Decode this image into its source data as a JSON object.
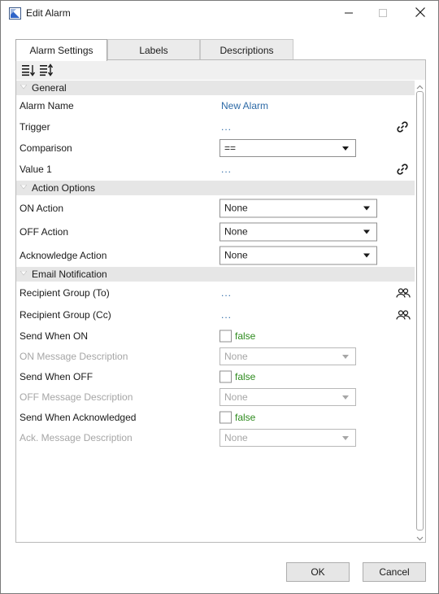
{
  "window": {
    "title": "Edit Alarm",
    "icons": [
      "app-icon",
      "minimize-icon",
      "maximize-icon",
      "close-icon"
    ]
  },
  "tabs": [
    {
      "label": "Alarm Settings",
      "active": true
    },
    {
      "label": "Labels",
      "active": false
    },
    {
      "label": "Descriptions",
      "active": false
    }
  ],
  "toolbar": {
    "icons": [
      "sort-categorized-icon",
      "sort-alphabetical-icon"
    ]
  },
  "sections": {
    "general": {
      "title": "General",
      "alarm_name": {
        "label": "Alarm Name",
        "value": "New Alarm"
      },
      "trigger": {
        "label": "Trigger",
        "value": "..."
      },
      "comparison": {
        "label": "Comparison",
        "value": "=="
      },
      "value1": {
        "label": "Value 1",
        "value": "..."
      }
    },
    "action_options": {
      "title": "Action Options",
      "on_action": {
        "label": "ON Action",
        "value": "None"
      },
      "off_action": {
        "label": "OFF Action",
        "value": "None"
      },
      "ack_action": {
        "label": "Acknowledge Action",
        "value": "None"
      }
    },
    "email": {
      "title": "Email Notification",
      "recipient_to": {
        "label": "Recipient Group (To)",
        "value": "..."
      },
      "recipient_cc": {
        "label": "Recipient Group (Cc)",
        "value": "..."
      },
      "send_on": {
        "label": "Send When ON",
        "value": "false",
        "checked": false
      },
      "on_msg": {
        "label": "ON Message Description",
        "value": "None",
        "disabled": true
      },
      "send_off": {
        "label": "Send When OFF",
        "value": "false",
        "checked": false
      },
      "off_msg": {
        "label": "OFF Message Description",
        "value": "None",
        "disabled": true
      },
      "send_ack": {
        "label": "Send When Acknowledged",
        "value": "false",
        "checked": false
      },
      "ack_msg": {
        "label": "Ack. Message Description",
        "value": "None",
        "disabled": true
      }
    }
  },
  "buttons": {
    "ok": "OK",
    "cancel": "Cancel"
  },
  "colors": {
    "link": "#2d6aa6",
    "bool_value": "#2e8b1e",
    "disabled_text": "#a6a6a6",
    "category_bg": "#e6e6e6"
  }
}
